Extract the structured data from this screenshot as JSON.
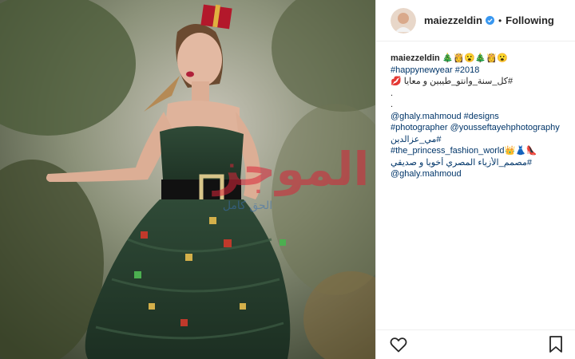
{
  "post": {
    "username": "maiezzeldin",
    "follow_status": "Following",
    "separator": "•",
    "caption_lines": [
      {
        "user": "maiezzeldin",
        "text": " 🎄👸😮🎄👸😮"
      },
      {
        "text": "#happynewyear #2018",
        "link": true
      },
      {
        "text": "#كل_سنة_وانتو_طيبين و معايا 💋",
        "rtl": true
      },
      {
        "text": "."
      },
      {
        "text": "."
      },
      {
        "text": "@ghaly.mahmoud #designs",
        "link": true
      },
      {
        "text": "#photographer @youssef​tayehphotography",
        "link": true
      },
      {
        "text": "#مي_عزالدين",
        "link": true,
        "rtl": true
      },
      {
        "text": "#the_princess_fashion_world👑👗👠",
        "link": true
      },
      {
        "text": "#مصمم_الأزياء المصري أخويا و صديقي",
        "rtl": true
      },
      {
        "text": "@ghaly.mahmoud",
        "link": true
      }
    ]
  },
  "watermark": {
    "main": "الموجز",
    "sub": "الحق كامل"
  },
  "colors": {
    "link": "#003569",
    "text": "#262626",
    "verified": "#3897f0",
    "watermark": "#d9263a"
  },
  "icons": [
    "heart-icon",
    "bookmark-icon",
    "verified-icon"
  ]
}
